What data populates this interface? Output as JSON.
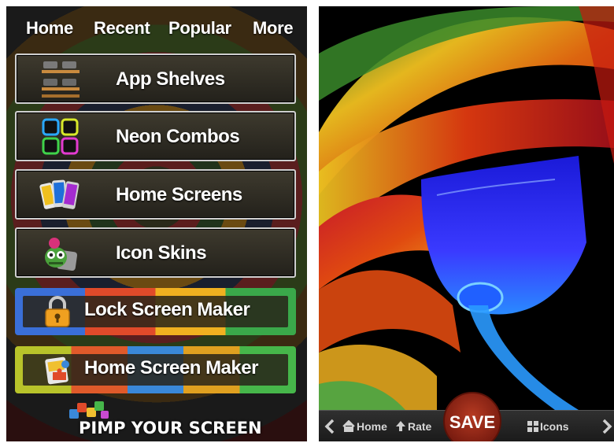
{
  "left": {
    "nav": [
      "Home",
      "Recent",
      "Popular",
      "More"
    ],
    "menu": [
      {
        "label": "App Shelves",
        "icon": "app-shelves-icon"
      },
      {
        "label": "Neon Combos",
        "icon": "neon-combos-icon"
      },
      {
        "label": "Home Screens",
        "icon": "home-screens-icon"
      },
      {
        "label": "Icon Skins",
        "icon": "icon-skins-icon"
      }
    ],
    "makers": [
      {
        "label": "Lock Screen Maker",
        "icon": "padlock-icon"
      },
      {
        "label": "Home Screen Maker",
        "icon": "puzzle-icon"
      }
    ],
    "logo_text": "PIMP YOUR SCREEN"
  },
  "right": {
    "bottom_bar": {
      "home_label": "Home",
      "rate_label": "Rate",
      "save_label": "SAVE",
      "icons_label": "Icons"
    }
  },
  "colors": {
    "button_border": "#cfcfcf",
    "save_button": "#9a2a18",
    "bar_background": "#262626"
  }
}
